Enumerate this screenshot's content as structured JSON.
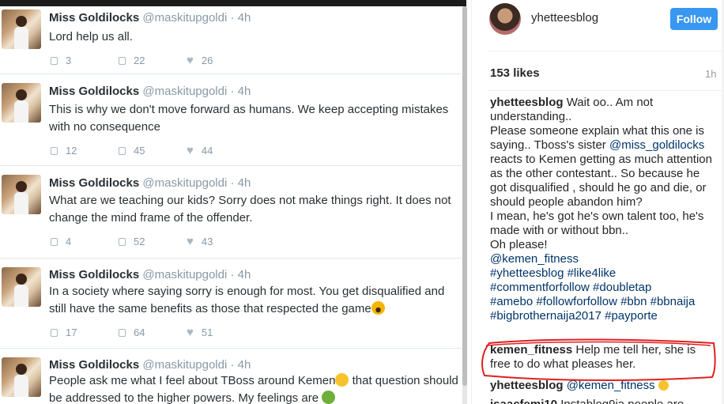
{
  "twitter": {
    "tweets": [
      {
        "name": "Miss Goldilocks",
        "handle": "@maskitupgoldi",
        "sep": " · ",
        "time": "4h",
        "lines": [
          "Lord help us all."
        ],
        "replies": "3",
        "retweets": "22",
        "likes": "26"
      },
      {
        "name": "Miss Goldilocks",
        "handle": "@maskitupgoldi",
        "sep": " · ",
        "time": "4h",
        "lines": [
          "This is why we don't move forward as humans. We keep accepting mistakes",
          "with no consequence"
        ],
        "replies": "12",
        "retweets": "45",
        "likes": "44"
      },
      {
        "name": "Miss Goldilocks",
        "handle": "@maskitupgoldi",
        "sep": " · ",
        "time": "4h",
        "lines": [
          "What are we teaching our kids? Sorry does not make things right. It does not",
          "change the mind frame of the offender."
        ],
        "replies": "4",
        "retweets": "52",
        "likes": "43"
      },
      {
        "name": "Miss Goldilocks",
        "handle": "@maskitupgoldi",
        "sep": " · ",
        "time": "4h",
        "lines": [
          "In a society where saying sorry is enough for most. You get disqualified and",
          "still have the same benefits as those that respected the game"
        ],
        "replies": "17",
        "retweets": "64",
        "likes": "51"
      },
      {
        "name": "Miss Goldilocks",
        "handle": "@maskitupgoldi",
        "sep": " · ",
        "time": "4h",
        "lines": [
          "People ask me what I feel about TBoss around Kemen",
          " that question should",
          "be addressed to the higher powers. My feelings are "
        ],
        "replies": "",
        "retweets": "",
        "likes": ""
      }
    ],
    "colors": {
      "name": "#292f33",
      "muted": "#8899a6"
    }
  },
  "instagram": {
    "username": "yhetteesblog",
    "follow_label": "Follow",
    "likes": "153 likes",
    "ago": "1h",
    "caption": {
      "user": "yhetteesblog",
      "p1": " Wait oo.. Am not understanding..",
      "p2": "Please someone explain what this one is saying.. Tboss's sister ",
      "mention": "@miss_goldilocks",
      "p3": " reacts to Kemen getting as much attention as the other contestant.. So because he got disqualified , should he go and die, or should people abandon him?",
      "p4": "I mean, he's got he's own talent too, he's made with or without bbn..",
      "p5": "Oh please!",
      "mention2": "@kemen_fitness",
      "tags1": "#yhetteesblog #like4like",
      "tags2": "#commentforfollow #doubletap",
      "tags3": "#amebo #followforfollow #bbn #bbnaija",
      "tags4": "#bigbrothernaija2017 #payporte"
    },
    "comment1": {
      "user": "kemen_fitness",
      "text": " Help me tell her, she is free to do what pleases her."
    },
    "comment2": {
      "user": "yhetteesblog",
      "mention": "@kemen_fitness"
    },
    "comment3": {
      "user": "isaacfemi10",
      "text": " Instablog9ja people are"
    },
    "colors": {
      "follow": "#3897f0",
      "link": "#003569",
      "annotation": "#e02020"
    }
  }
}
